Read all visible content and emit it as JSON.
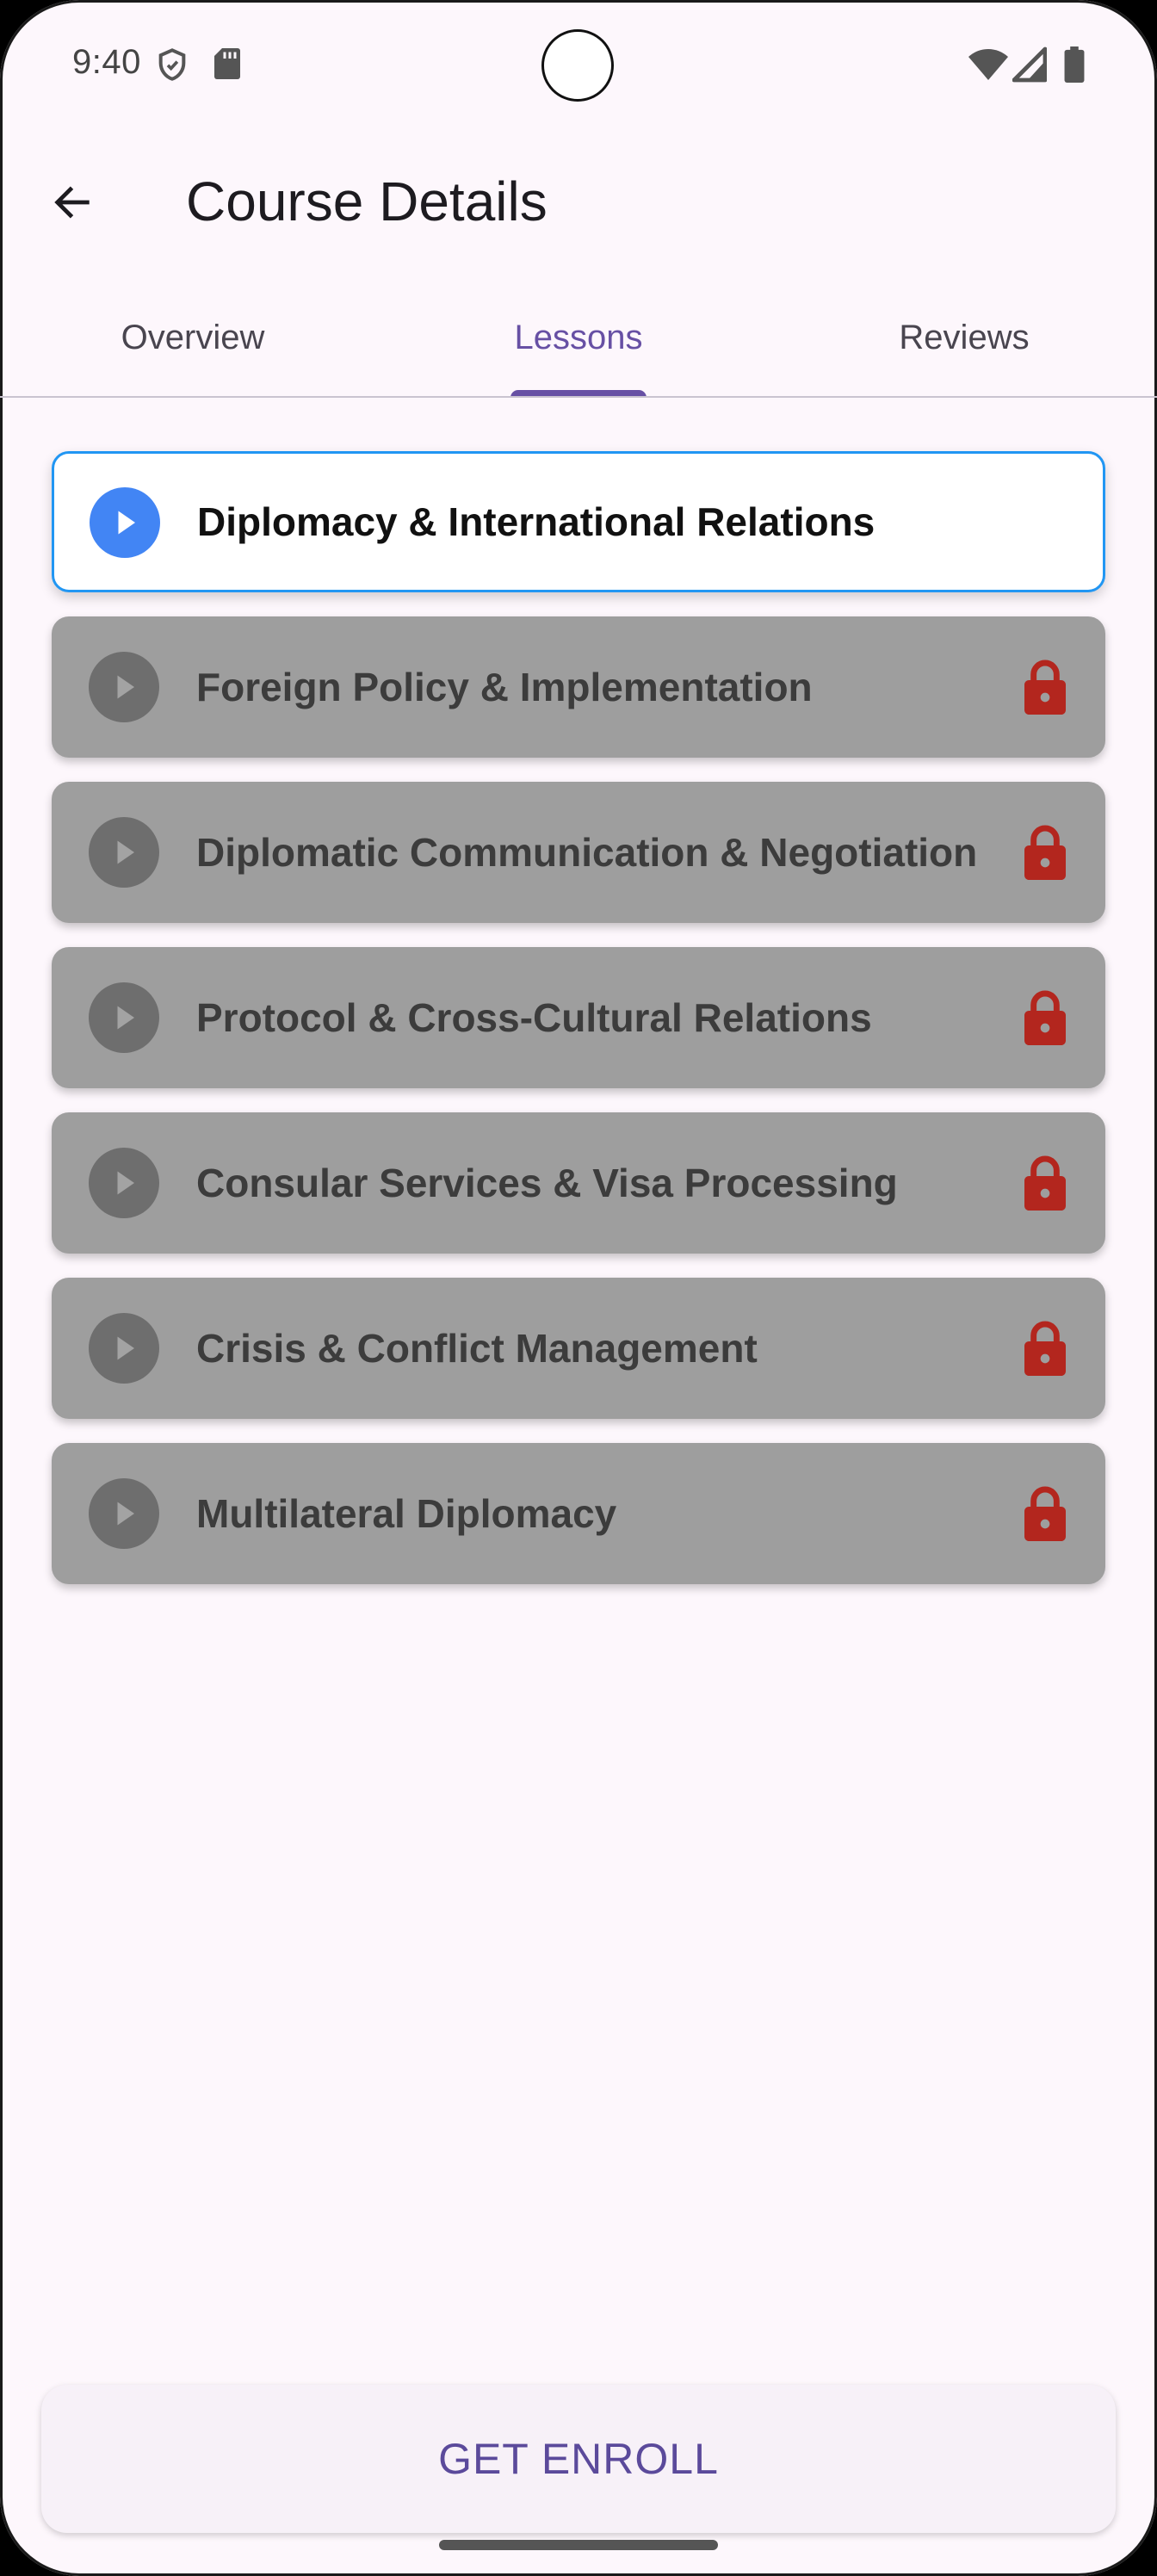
{
  "status_bar": {
    "time": "9:40",
    "icons": [
      "shield-icon",
      "sd-card-icon",
      "wifi-icon",
      "signal-icon",
      "battery-icon"
    ]
  },
  "app_bar": {
    "back_icon": "arrow-back-icon",
    "title": "Course Details"
  },
  "tabs": [
    {
      "label": "Overview",
      "active": false
    },
    {
      "label": "Lessons",
      "active": true
    },
    {
      "label": "Reviews",
      "active": false
    }
  ],
  "lessons": [
    {
      "title": "Diplomacy & International Relations",
      "locked": false
    },
    {
      "title": "Foreign Policy & Implementation",
      "locked": true
    },
    {
      "title": "Diplomatic Communication & Negotiation",
      "locked": true
    },
    {
      "title": "Protocol & Cross-Cultural Relations",
      "locked": true
    },
    {
      "title": "Consular Services & Visa Processing",
      "locked": true
    },
    {
      "title": "Crisis & Conflict Management",
      "locked": true
    },
    {
      "title": "Multilateral Diplomacy",
      "locked": true
    }
  ],
  "enroll_button": {
    "label": "GET ENROLL"
  },
  "colors": {
    "accent": "#6750A4",
    "active_lesson_border": "#2196F3",
    "play_active": "#4285F4",
    "locked_card": "#9E9E9E",
    "lock_icon": "#B3261E"
  }
}
